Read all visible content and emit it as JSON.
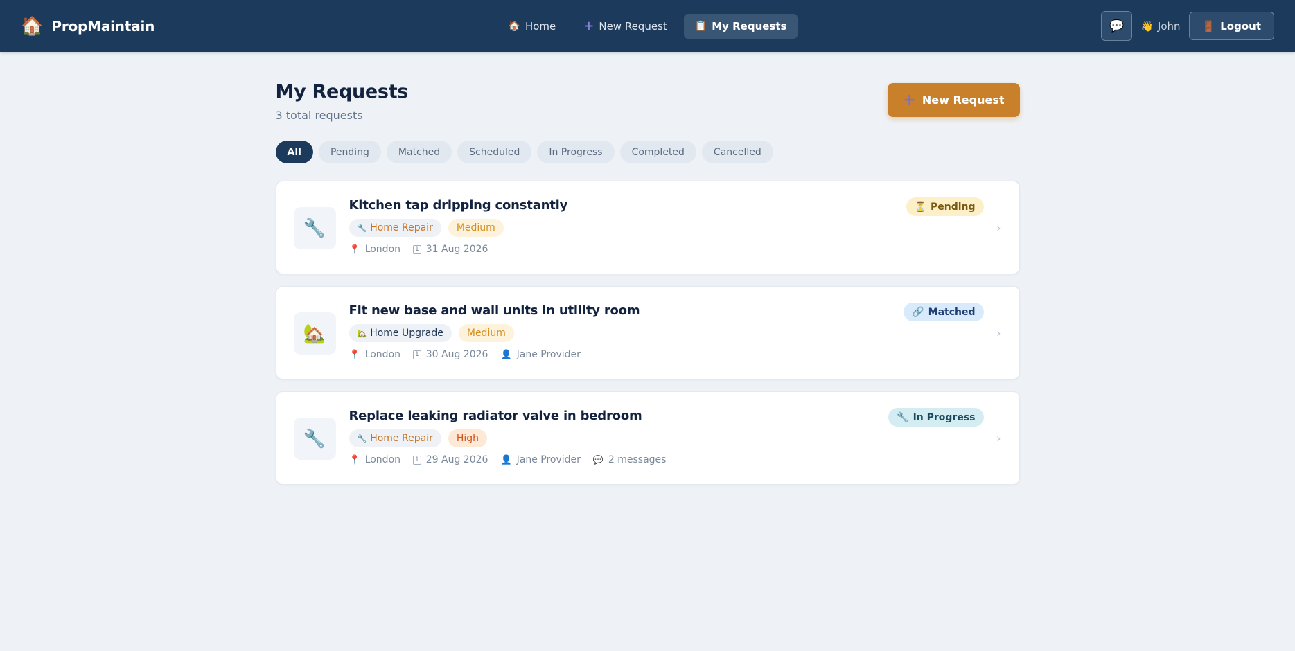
{
  "brand": {
    "icon": "🏠",
    "name": "PropMaintain"
  },
  "nav": [
    {
      "icon": "🏠",
      "label": "Home",
      "active": false
    },
    {
      "icon": "+",
      "label": "New Request",
      "active": false
    },
    {
      "icon": "📋",
      "label": "My Requests",
      "active": true
    }
  ],
  "topbar": {
    "chat_icon": "💬",
    "greeting_icon": "👋",
    "user_name": "John",
    "logout_icon": "🚪",
    "logout_label": "Logout"
  },
  "page": {
    "title": "My Requests",
    "subtitle": "3 total requests",
    "new_request_label": "New Request",
    "new_request_icon": "+"
  },
  "filters": [
    "All",
    "Pending",
    "Matched",
    "Scheduled",
    "In Progress",
    "Completed",
    "Cancelled"
  ],
  "active_filter": "All",
  "requests": [
    {
      "title": "Kitchen tap dripping constantly",
      "thumb_icon": "🔧",
      "category": "Home Repair",
      "category_icon": "🔧",
      "priority": "Medium",
      "location": "London",
      "date": "31 Aug 2026",
      "status": "Pending",
      "status_icon": "⏳"
    },
    {
      "title": "Fit new base and wall units in utility room",
      "thumb_icon": "🏡",
      "category": "Home Upgrade",
      "category_icon": "🏡",
      "priority": "Medium",
      "location": "London",
      "date": "30 Aug 2026",
      "provider": "Jane Provider",
      "status": "Matched",
      "status_icon": "🔗"
    },
    {
      "title": "Replace leaking radiator valve in bedroom",
      "thumb_icon": "🔧",
      "category": "Home Repair",
      "category_icon": "🔧",
      "priority": "High",
      "location": "London",
      "date": "29 Aug 2026",
      "provider": "Jane Provider",
      "messages": "2 messages",
      "status": "In Progress",
      "status_icon": "🔧"
    }
  ],
  "icons": {
    "pin": "pin-icon",
    "calendar": "calendar-icon",
    "person": "person-icon",
    "message": "message-icon",
    "chevron": "chevron-right-icon"
  },
  "colors": {
    "navbar": "#1b3a5c",
    "accent": "#c8802a",
    "background": "#eef2f7"
  }
}
